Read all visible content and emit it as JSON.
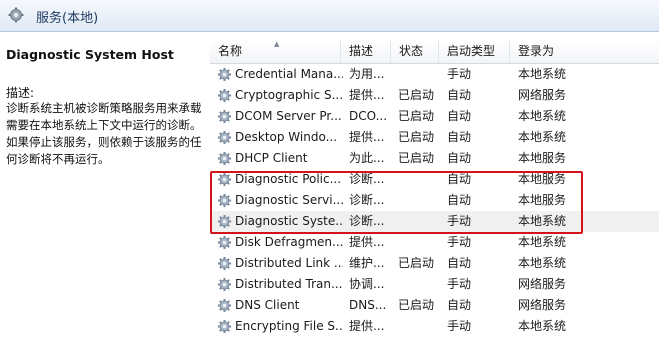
{
  "window": {
    "title": "服务(本地)"
  },
  "detail": {
    "service_name": "Diagnostic System Host",
    "description_label": "描述:",
    "description_text": "诊断系统主机被诊断策略服务用来承载需要在本地系统上下文中运行的诊断。如果停止该服务，则依赖于该服务的任何诊断将不再运行。"
  },
  "columns": {
    "name": "名称",
    "description": "描述",
    "status": "状态",
    "startup": "启动类型",
    "logon": "登录为"
  },
  "services": [
    {
      "name": "Credential Mana...",
      "description": "为用...",
      "status": "",
      "startup": "手动",
      "logon": "本地系统"
    },
    {
      "name": "Cryptographic S...",
      "description": "提供...",
      "status": "已启动",
      "startup": "自动",
      "logon": "网络服务"
    },
    {
      "name": "DCOM Server Pr...",
      "description": "DCO...",
      "status": "已启动",
      "startup": "自动",
      "logon": "本地系统"
    },
    {
      "name": "Desktop Windo...",
      "description": "提供...",
      "status": "已启动",
      "startup": "自动",
      "logon": "本地系统"
    },
    {
      "name": "DHCP Client",
      "description": "为此...",
      "status": "已启动",
      "startup": "自动",
      "logon": "本地服务"
    },
    {
      "name": "Diagnostic Polic...",
      "description": "诊断...",
      "status": "",
      "startup": "自动",
      "logon": "本地服务"
    },
    {
      "name": "Diagnostic Servi...",
      "description": "诊断...",
      "status": "",
      "startup": "自动",
      "logon": "本地服务"
    },
    {
      "name": "Diagnostic Syste...",
      "description": "诊断...",
      "status": "",
      "startup": "手动",
      "logon": "本地系统"
    },
    {
      "name": "Disk Defragmen...",
      "description": "提供...",
      "status": "",
      "startup": "手动",
      "logon": "本地系统"
    },
    {
      "name": "Distributed Link ...",
      "description": "维护...",
      "status": "已启动",
      "startup": "自动",
      "logon": "本地系统"
    },
    {
      "name": "Distributed Tran...",
      "description": "协调...",
      "status": "",
      "startup": "手动",
      "logon": "网络服务"
    },
    {
      "name": "DNS Client",
      "description": "DNS...",
      "status": "已启动",
      "startup": "自动",
      "logon": "网络服务"
    },
    {
      "name": "Encrypting File S...",
      "description": "提供...",
      "status": "",
      "startup": "手动",
      "logon": "本地系统"
    }
  ],
  "selected_service": "Diagnostic Syste...",
  "colors": {
    "highlight_box": "#d4141c",
    "selected_row": "#f0f0f0",
    "header_bg": "#f2f4f7"
  }
}
